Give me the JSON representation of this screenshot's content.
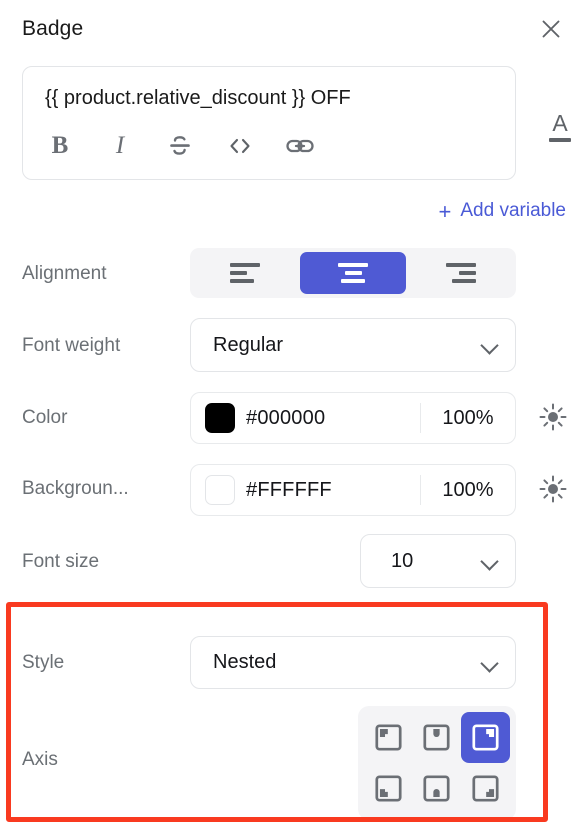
{
  "header": {
    "title": "Badge",
    "close_icon": "close-icon"
  },
  "editor": {
    "content": "{{ product.relative_discount }} OFF",
    "toolbar": [
      {
        "name": "bold-button",
        "label": "B",
        "icon": "bold-icon"
      },
      {
        "name": "italic-button",
        "label": "I",
        "icon": "italic-icon"
      },
      {
        "name": "strikethrough-button",
        "label": "S",
        "icon": "strikethrough-icon"
      },
      {
        "name": "code-button",
        "label": "<>",
        "icon": "code-icon"
      },
      {
        "name": "link-button",
        "label": "",
        "icon": "link-icon"
      }
    ],
    "text_color_button": {
      "glyph": "A",
      "icon": "text-color-icon"
    }
  },
  "add_variable": {
    "plus": "+",
    "label": "Add variable"
  },
  "fields": {
    "alignment": {
      "label": "Alignment",
      "options": [
        "left",
        "center",
        "right"
      ],
      "selected": "center"
    },
    "font_weight": {
      "label": "Font weight",
      "value": "Regular"
    },
    "color": {
      "label": "Color",
      "hex": "#000000",
      "swatch": "#000000",
      "opacity": "100%",
      "brightness_icon": "brightness-icon"
    },
    "background": {
      "label": "Backgroun...",
      "hex": "#FFFFFF",
      "swatch": "#FFFFFF",
      "opacity": "100%",
      "brightness_icon": "brightness-icon"
    },
    "font_size": {
      "label": "Font size",
      "value": "10"
    },
    "style": {
      "label": "Style",
      "value": "Nested"
    },
    "axis": {
      "label": "Axis",
      "options": [
        {
          "name": "axis-top-left",
          "icon": "corner-top-left-icon"
        },
        {
          "name": "axis-top-center",
          "icon": "notch-top-center-icon"
        },
        {
          "name": "axis-top-right",
          "icon": "corner-top-right-icon"
        },
        {
          "name": "axis-bottom-left",
          "icon": "corner-bottom-left-icon"
        },
        {
          "name": "axis-bottom-center",
          "icon": "notch-bottom-center-icon"
        },
        {
          "name": "axis-bottom-right",
          "icon": "corner-bottom-right-icon"
        }
      ],
      "selected_index": 2
    }
  },
  "colors": {
    "accent": "#4F5AD4",
    "link": "#4A5AD6",
    "highlight": "#F93A20",
    "label_text": "#6B7075",
    "value_text": "#15161A",
    "icon_gray": "#5F6368",
    "track": "#F4F4F6",
    "border": "#E3E5E8"
  }
}
